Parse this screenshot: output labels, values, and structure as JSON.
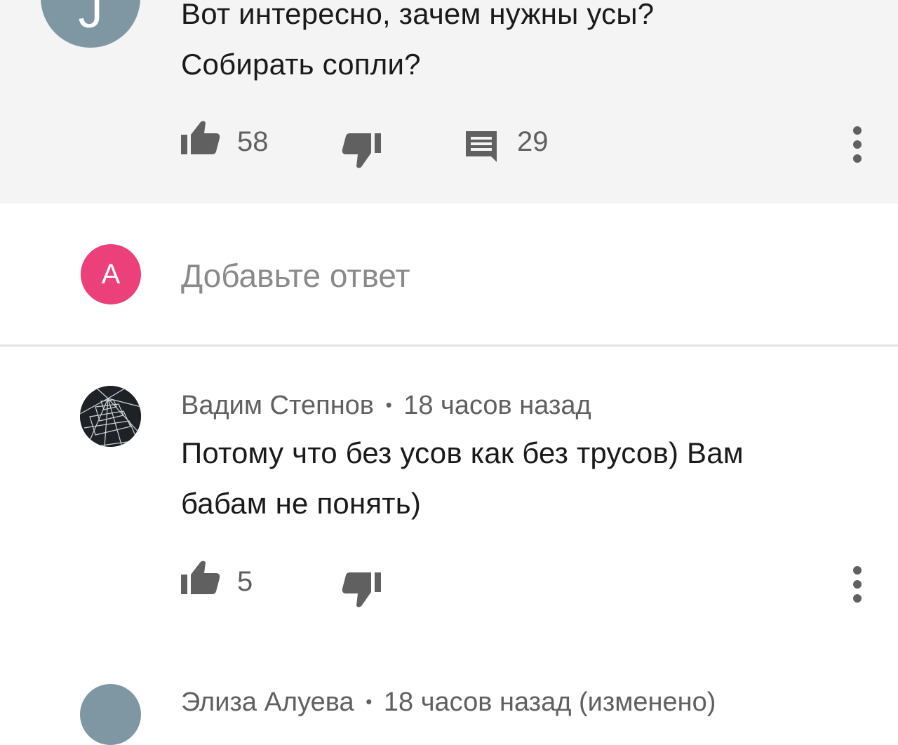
{
  "comment_1": {
    "avatar_letter": "J",
    "text_line1": "Вот интересно,  зачем нужны усы?",
    "text_line2": "Собирать сопли?",
    "likes": "58",
    "replies": "29"
  },
  "reply_box": {
    "avatar_letter": "A",
    "placeholder": "Добавьте ответ"
  },
  "comment_2": {
    "author": "Вадим Степнов",
    "separator": "•",
    "time": "18 часов назад",
    "text_line1": "Потому что без усов как без трусов) Вам",
    "text_line2": "бабам не понять)",
    "likes": "5"
  },
  "comment_3": {
    "author": "Элиза Алуева",
    "separator": "•",
    "time": "18 часов назад (изменено)"
  },
  "colors": {
    "highlight_bg": "#f4f4f4",
    "user_avatar": "#ec407a",
    "channel_avatar": "#7f97a3",
    "icon_gray": "#606060"
  },
  "icons": [
    "thumb-up-icon",
    "thumb-down-icon",
    "reply-comment-icon",
    "more-vert-icon"
  ]
}
